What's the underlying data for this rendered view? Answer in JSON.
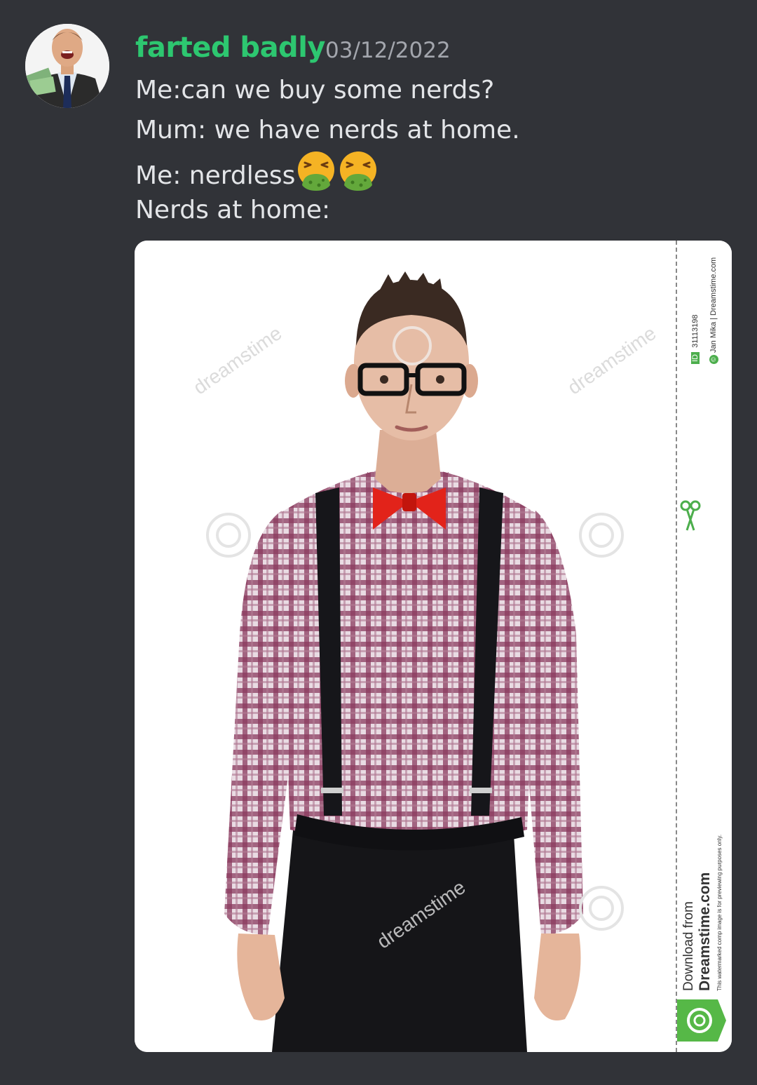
{
  "message": {
    "author": "farted badly",
    "timestamp": "03/12/2022",
    "lines": [
      "Me:can we buy some nerds?",
      "Mum: we have nerds at home.",
      "Me: nerdless",
      "Nerds at home:"
    ],
    "emojis": [
      "nauseated-face-icon",
      "nauseated-face-icon"
    ],
    "author_color": "#2dc770"
  },
  "attachment": {
    "watermark": "dreamstime",
    "image_id_label": "ID",
    "image_id": "31113198",
    "credit": "Jan Mika | Dreamstime.com",
    "download_from": "Download from",
    "site": "Dreamstime.com",
    "disclaimer": "This watermarked comp image is for previewing purposes only."
  }
}
